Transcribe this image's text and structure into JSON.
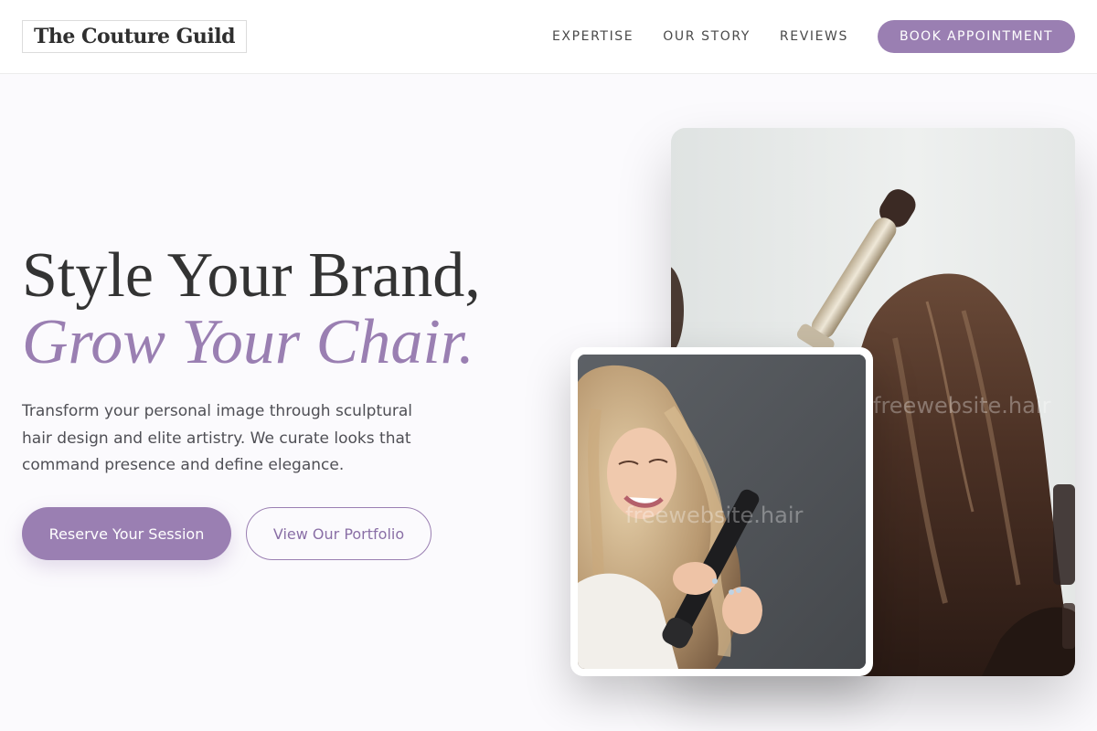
{
  "header": {
    "logo": "The Couture Guild",
    "nav": [
      {
        "label": "EXPERTISE"
      },
      {
        "label": "OUR STORY"
      },
      {
        "label": "REVIEWS"
      }
    ],
    "cta_label": "BOOK APPOINTMENT"
  },
  "hero": {
    "title_line1": "Style Your Brand,",
    "title_line2": "Grow Your Chair.",
    "subtitle": "Transform your personal image through sculptural hair design and elite artistry. We curate looks that command presence and define elegance.",
    "primary_button": "Reserve Your Session",
    "secondary_button": "View Our Portfolio"
  },
  "images": {
    "main_watermark": "freewebsite.hair",
    "inset_watermark": "freewebsite.hair"
  },
  "colors": {
    "accent": "#9a7fb2",
    "text_dark": "#333333",
    "background": "#fbfafd"
  }
}
